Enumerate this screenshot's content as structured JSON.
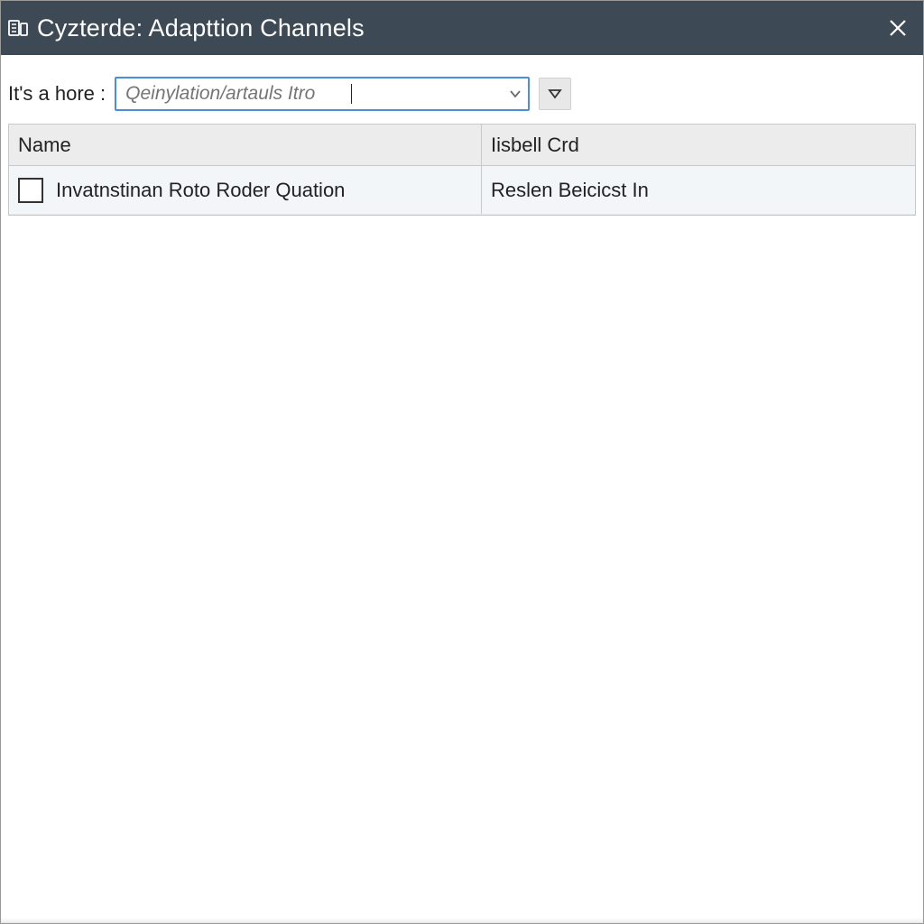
{
  "titlebar": {
    "title": "Cyzterde: Adapttion Channels"
  },
  "filter": {
    "label": "It's a hore :",
    "placeholder": "Qeinylation/artauls Itro"
  },
  "table": {
    "columns": [
      "Name",
      "Iisbell Crd"
    ],
    "rows": [
      {
        "name": "Invatnstinan Roto Roder Quation",
        "crd": "Reslen Beicicst In"
      }
    ]
  }
}
